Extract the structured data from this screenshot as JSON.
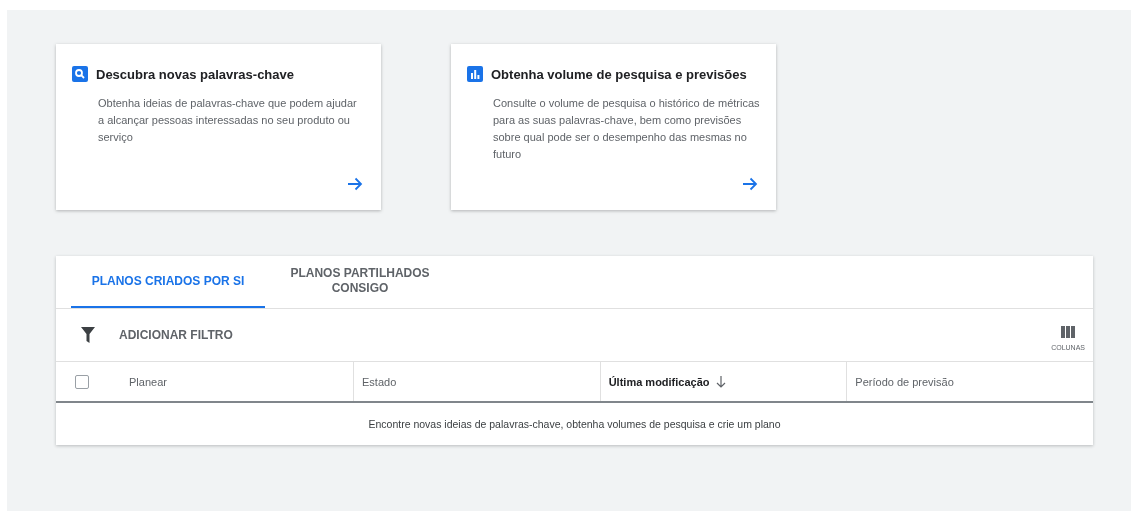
{
  "cards": [
    {
      "kind": "search",
      "title": "Descubra novas palavras-chave",
      "description": "Obtenha ideias de palavras-chave que podem ajudar a alcançar pessoas interessadas no seu produto ou serviço"
    },
    {
      "kind": "chart",
      "title": "Obtenha volume de pesquisa e previsões",
      "description": "Consulte o volume de pesquisa o histórico de métricas para as suas palavras-chave, bem como previsões sobre qual pode ser o desempenho das mesmas no futuro"
    }
  ],
  "plans": {
    "tabs": [
      {
        "label": "PLANOS CRIADOS POR SI",
        "selected": true
      },
      {
        "label": "PLANOS PARTILHADOS CONSIGO",
        "selected": false
      }
    ],
    "filter_label": "ADICIONAR FILTRO",
    "columns_label": "COLUNAS",
    "select_all_checked": false,
    "columns": [
      {
        "label": "Planear",
        "sorted": false
      },
      {
        "label": "Estado",
        "sorted": false
      },
      {
        "label": "Última modificação",
        "sorted": true
      },
      {
        "label": "Período de previsão",
        "sorted": false
      }
    ],
    "empty_message": "Encontre novas ideias de palavras-chave, obtenha volumes de pesquisa e crie um plano"
  }
}
